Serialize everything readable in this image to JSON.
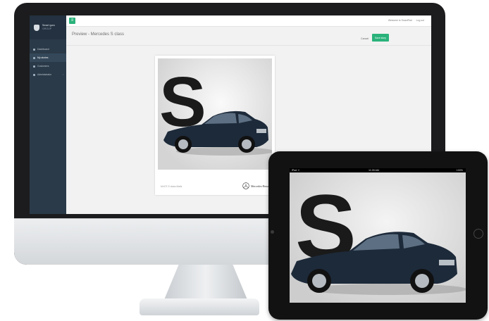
{
  "app": {
    "logo_line1": "Smart guru",
    "logo_line2": "GROUP"
  },
  "sidebar": {
    "items": [
      {
        "label": "Dashboard"
      },
      {
        "label": "My stories"
      },
      {
        "label": "Customers"
      },
      {
        "label": "Administrator",
        "chevron": "›"
      }
    ]
  },
  "topbar": {
    "menu_icon": "≡",
    "welcome": "Welcome to SmartPad",
    "logout": "Log out"
  },
  "page": {
    "title": "Preview - Mercedes S class",
    "cancel_label": "Cancel",
    "save_label": "Save story"
  },
  "preview": {
    "footer_left": "Mr/OT-S class Mails",
    "brand_name": "Mercedes-Benz",
    "ad_letter": "S"
  },
  "ipad": {
    "carrier": "iPad ᯤ",
    "time": "11:09 AM",
    "battery": "100%"
  },
  "colors": {
    "accent": "#2ab27b",
    "sidebar": "#2b3a48",
    "car_body": "#1d2a3a"
  }
}
